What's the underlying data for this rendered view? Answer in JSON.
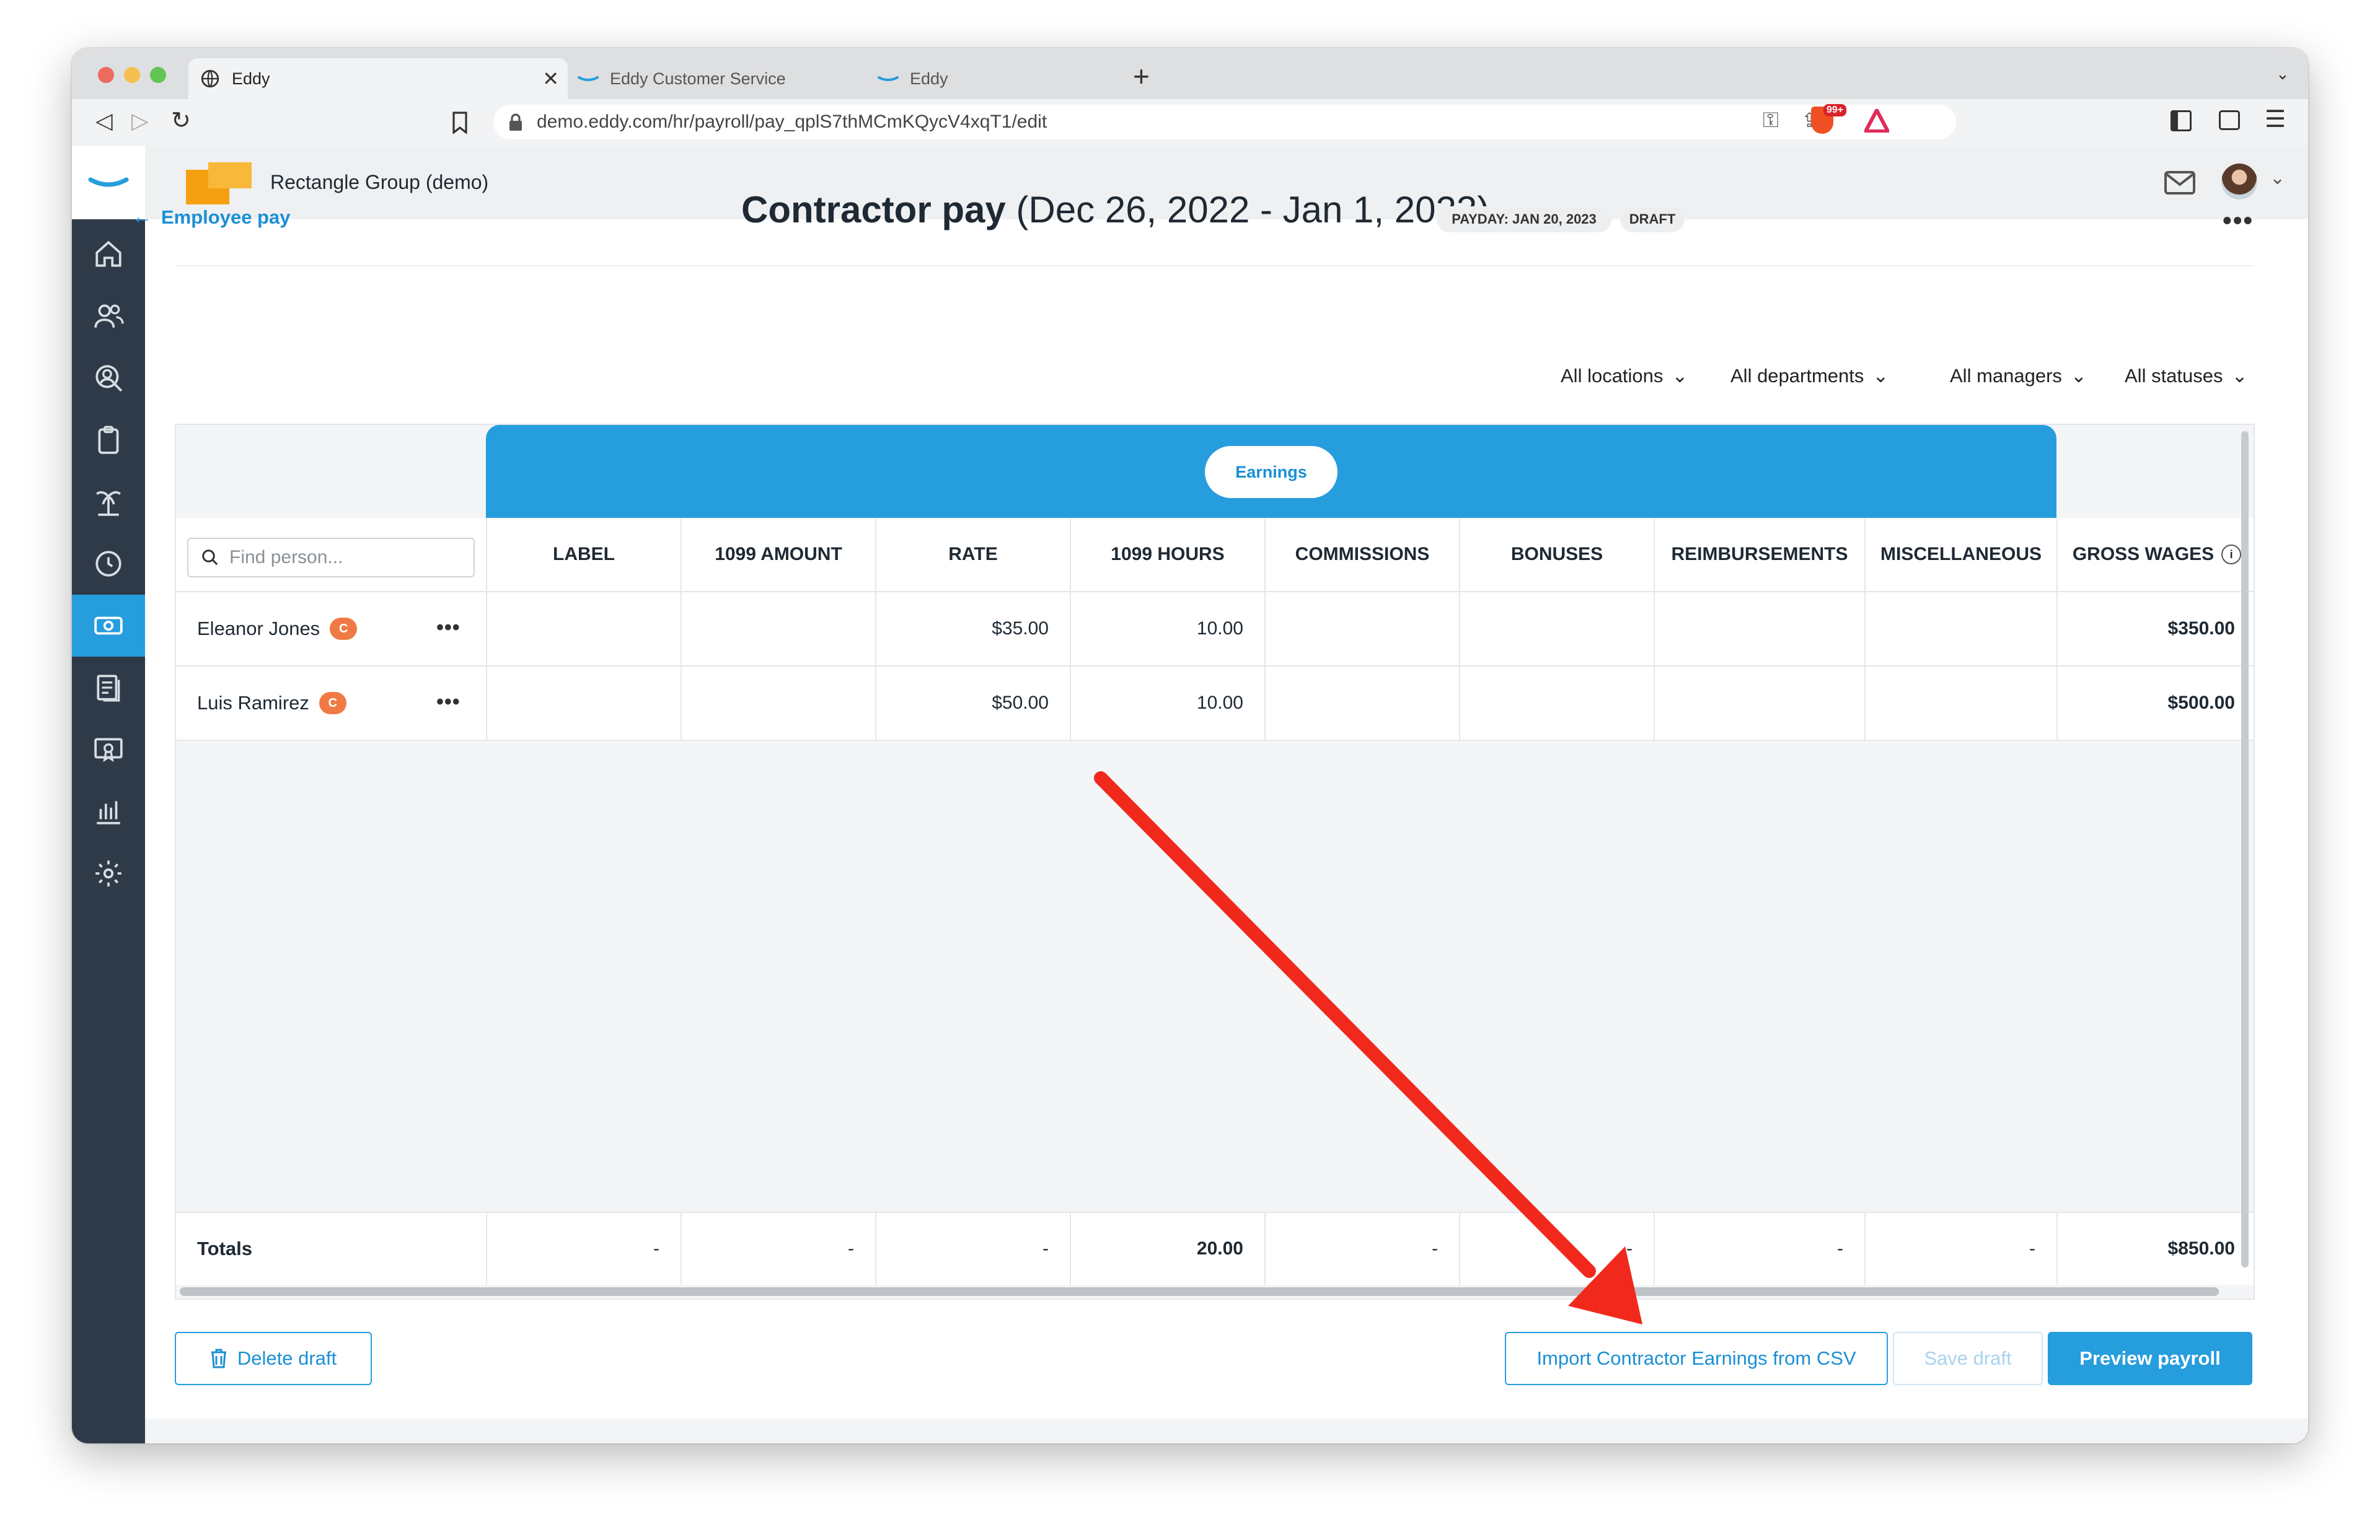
{
  "browser": {
    "tabs": [
      {
        "label": "Eddy",
        "active": true
      },
      {
        "label": "Eddy Customer Service",
        "active": false
      },
      {
        "label": "Eddy",
        "active": false
      }
    ],
    "url": "demo.eddy.com/hr/payroll/pay_qplS7thMCmKQycV4xqT1/edit",
    "extension_badge": "99+"
  },
  "app": {
    "company": "Rectangle Group (demo)",
    "sidebar_icons": [
      "home-icon",
      "people-icon",
      "person-search-icon",
      "clipboard-icon",
      "vacation-icon",
      "clock-icon",
      "payroll-icon",
      "documents-icon",
      "certificate-icon",
      "reports-icon",
      "settings-icon",
      "help-icon"
    ]
  },
  "page": {
    "back_link": "Employee pay",
    "title_bold": "Contractor pay",
    "title_range": "(Dec 26, 2022 - Jan 1, 2023)",
    "payday_pill": "PAYDAY: JAN 20, 2023",
    "status_pill": "DRAFT",
    "more": "•••"
  },
  "filters": [
    "All locations",
    "All departments",
    "All managers",
    "All statuses"
  ],
  "table": {
    "group_label": "Earnings",
    "search_placeholder": "Find person...",
    "columns": [
      "LABEL",
      "1099 AMOUNT",
      "RATE",
      "1099 HOURS",
      "COMMISSIONS",
      "BONUSES",
      "REIMBURSEMENTS",
      "MISCELLANEOUS",
      "GROSS WAGES"
    ],
    "rows": [
      {
        "name": "Eleanor Jones",
        "badge": "C",
        "label": "",
        "amount_1099": "",
        "rate": "$35.00",
        "hours_1099": "10.00",
        "commissions": "",
        "bonuses": "",
        "reimbursements": "",
        "miscellaneous": "",
        "gross_wages": "$350.00"
      },
      {
        "name": "Luis Ramirez",
        "badge": "C",
        "label": "",
        "amount_1099": "",
        "rate": "$50.00",
        "hours_1099": "10.00",
        "commissions": "",
        "bonuses": "",
        "reimbursements": "",
        "miscellaneous": "",
        "gross_wages": "$500.00"
      }
    ],
    "row_menu": "•••",
    "totals": {
      "label": "Totals",
      "values": [
        "-",
        "-",
        "-",
        "20.00",
        "-",
        "-",
        "-",
        "-",
        "$850.00"
      ]
    }
  },
  "buttons": {
    "delete_draft": "Delete draft",
    "import_csv": "Import Contractor Earnings from CSV",
    "save_draft": "Save draft",
    "preview_payroll": "Preview payroll"
  },
  "colors": {
    "accent": "#269ddd",
    "badge": "#f07a45",
    "sidebar": "#2e3a48",
    "annotation_arrow": "#f0291c"
  }
}
